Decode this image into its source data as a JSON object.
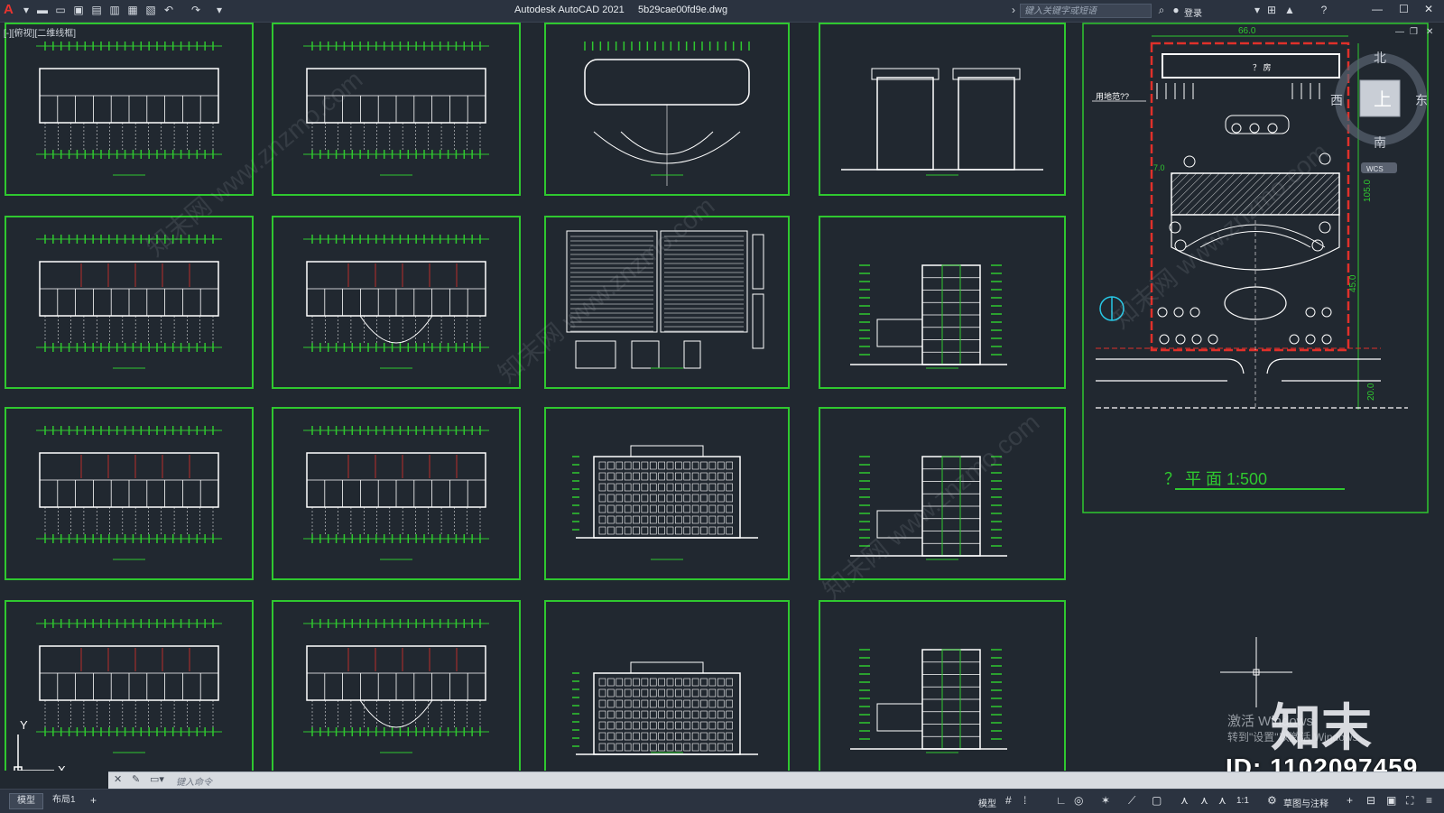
{
  "titlebar": {
    "app_title": "Autodesk AutoCAD 2021",
    "file_name": "5b29cae00fd9e.dwg",
    "search_placeholder": "键入关键字或短语",
    "login_label": "登录"
  },
  "viewport": {
    "label": "[-][俯视][二维线框]"
  },
  "site_plan": {
    "dimension_top": "66.0",
    "dimension_right_1": "105.0",
    "dimension_right_2": "45.0",
    "dimension_right_3": "20.0",
    "dimension_left": "7.0",
    "building_label": "？ 房",
    "land_label": "用地范??",
    "title": "？ 平  面 1:500"
  },
  "viewcube": {
    "north": "北",
    "south": "南",
    "east": "东",
    "west": "西",
    "top": "上",
    "wcs": "WCS"
  },
  "ucs": {
    "x": "X",
    "y": "Y"
  },
  "watermark": {
    "activate_title": "激活 Windows",
    "activate_sub": "转到\"设置\"以激活 Windows。",
    "logo": "知末",
    "id": "ID: 1102097459",
    "site_text": "知末网 www.znzmo.com"
  },
  "command": {
    "placeholder": "键入命令"
  },
  "tabs": [
    {
      "label": "模型",
      "active": true
    },
    {
      "label": "布局1",
      "active": false
    }
  ],
  "statusbar": {
    "model_label": "模型",
    "scale_label": "1:1",
    "annotation_label": "草图与注释"
  },
  "colors": {
    "background": "#212830",
    "sheet_border": "#2fc82f",
    "drawing_line": "#ffffff",
    "red_line": "#e0302a",
    "cyan": "#27c8e6"
  }
}
